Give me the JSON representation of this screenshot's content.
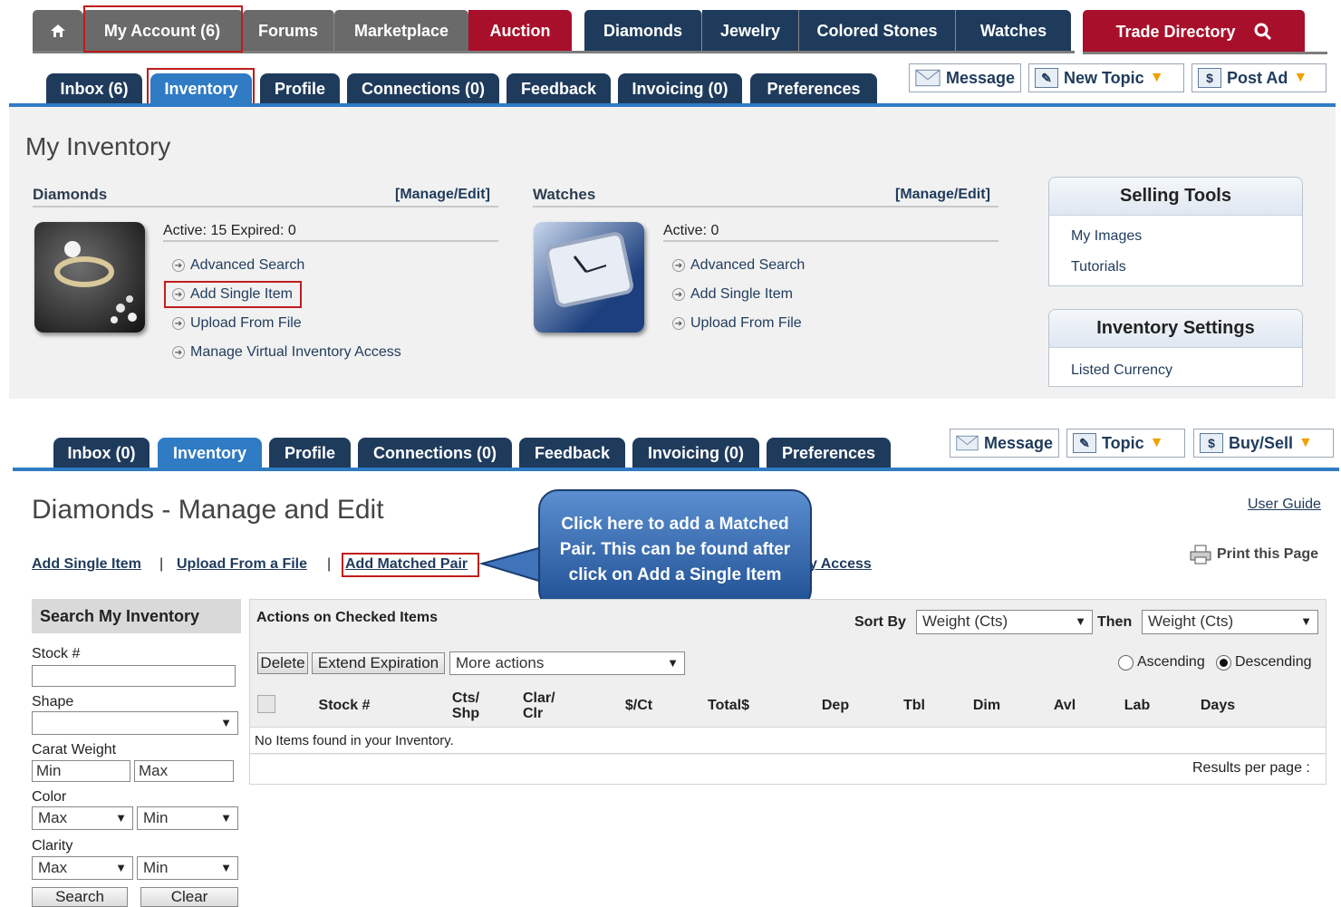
{
  "top_nav": {
    "home_icon": "home-icon",
    "items": [
      "My Account (6)",
      "Forums",
      "Marketplace",
      "Auction",
      "Diamonds",
      "Jewelry",
      "Colored Stones",
      "Watches",
      "Trade Directory"
    ],
    "search_icon": "search-icon"
  },
  "sub_tabs_1": [
    "Inbox (6)",
    "Inventory",
    "Profile",
    "Connections (0)",
    "Feedback",
    "Invoicing (0)",
    "Preferences"
  ],
  "actions_1": {
    "message": "Message",
    "new_topic": "New Topic",
    "post_ad": "Post Ad"
  },
  "inventory": {
    "title": "My Inventory",
    "diamonds": {
      "heading": "Diamonds",
      "manage": "[Manage/Edit]",
      "stat": "Active: 15   Expired: 0",
      "links": [
        "Advanced Search",
        "Add Single Item",
        "Upload From File",
        "Manage Virtual Inventory Access"
      ]
    },
    "watches": {
      "heading": "Watches",
      "manage": "[Manage/Edit]",
      "stat": "Active: 0",
      "links": [
        "Advanced Search",
        "Add Single Item",
        "Upload From File"
      ]
    },
    "selling_tools": {
      "title": "Selling Tools",
      "links": [
        "My Images",
        "Tutorials"
      ]
    },
    "inventory_settings": {
      "title": "Inventory Settings",
      "links": [
        "Listed Currency"
      ]
    }
  },
  "sub_tabs_2": [
    "Inbox (0)",
    "Inventory",
    "Profile",
    "Connections (0)",
    "Feedback",
    "Invoicing (0)",
    "Preferences"
  ],
  "actions_2": {
    "message": "Message",
    "topic": "Topic",
    "buy_sell": "Buy/Sell"
  },
  "manage": {
    "title": "Diamonds - Manage and Edit",
    "user_guide": "User Guide",
    "print": "Print this Page",
    "links": [
      "Add Single Item",
      "Upload From a File",
      "Add Matched Pair"
    ],
    "link_tail": "y Access",
    "callout": "Click here to add a Matched Pair. This can be found after click on Add a Single Item"
  },
  "search": {
    "title": "Search My Inventory",
    "stock_label": "Stock #",
    "shape_label": "Shape",
    "carat_label": "Carat Weight",
    "carat_min": "Min",
    "carat_max": "Max",
    "color_label": "Color",
    "color_max": "Max",
    "color_min": "Min",
    "clarity_label": "Clarity",
    "clarity_max": "Max",
    "clarity_min": "Min",
    "search_btn": "Search",
    "clear_btn": "Clear"
  },
  "grid": {
    "actions_title": "Actions on Checked Items",
    "sort_by": "Sort By",
    "sort_value": "Weight (Cts)",
    "then": "Then",
    "then_value": "Weight (Cts)",
    "delete": "Delete",
    "extend": "Extend Expiration",
    "more": "More actions",
    "ascending": "Ascending",
    "descending": "Descending",
    "columns": [
      "Stock #",
      "Cts/\nShp",
      "Clar/\nClr",
      "$/Ct",
      "Total$",
      "Dep",
      "Tbl",
      "Dim",
      "Avl",
      "Lab",
      "Days"
    ],
    "empty": "No Items found in your Inventory.",
    "results": "Results per page :"
  }
}
